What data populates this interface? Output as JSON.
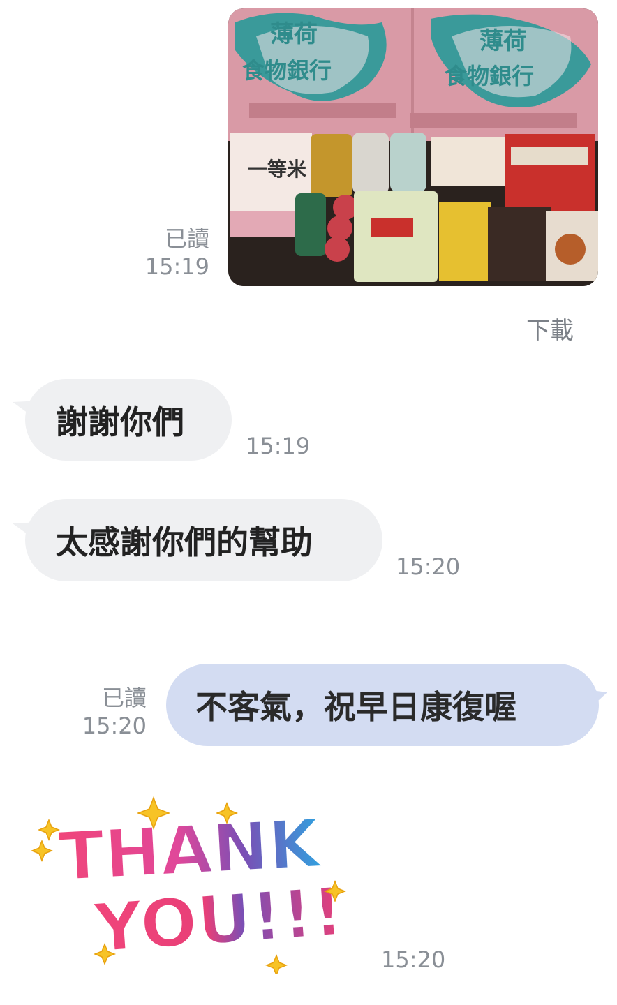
{
  "messages": {
    "m1": {
      "read": "已讀",
      "time": "15:19",
      "download": "下載"
    },
    "m2": {
      "text": "謝謝你們",
      "time": "15:19"
    },
    "m3": {
      "text": "太感謝你們的幫助",
      "time": "15:20"
    },
    "m4": {
      "text": "不客氣，祝早日康復喔",
      "read": "已讀",
      "time": "15:20"
    },
    "m5": {
      "sticker_line1": "THANK",
      "sticker_line2": "YOU!!!",
      "time": "15:20"
    }
  },
  "photo": {
    "box_title_line1": "薄荷",
    "box_title_line2": "食物銀行",
    "rice_label": "一等米"
  },
  "colors": {
    "incoming_bubble": "#eff0f2",
    "outgoing_bubble": "#d3dcf2",
    "meta_text": "#8a8f96",
    "sticker_pink": "#f0457a",
    "sticker_purple": "#7a4fb5",
    "sticker_blue": "#2fa3e0",
    "sparkle": "#f7c326"
  }
}
